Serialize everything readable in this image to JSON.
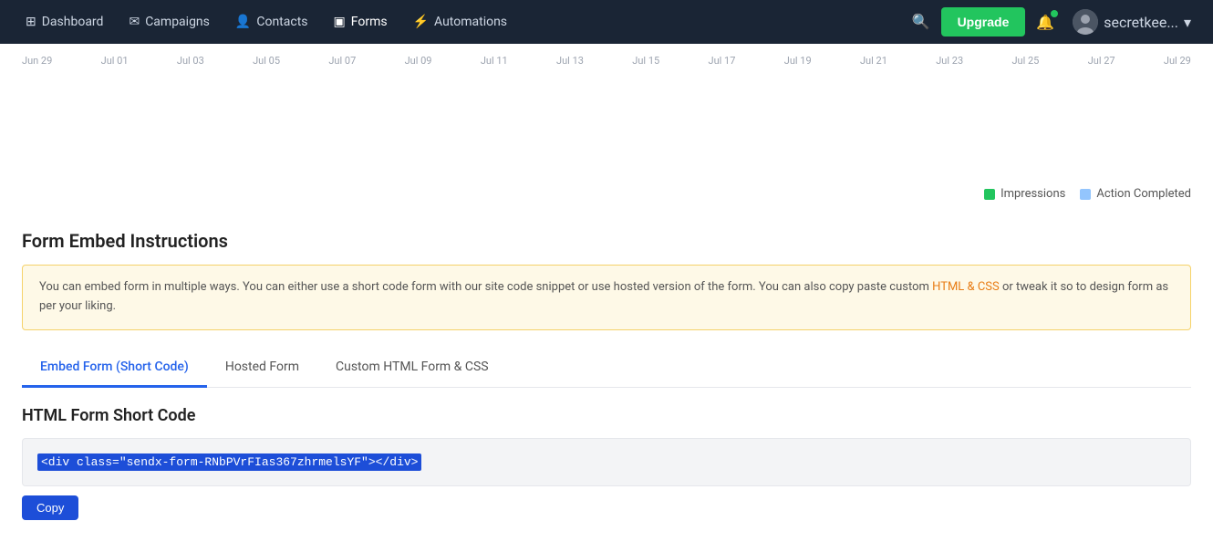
{
  "navbar": {
    "brand_icon": "⊞",
    "items": [
      {
        "id": "dashboard",
        "label": "Dashboard",
        "icon": "grid-icon",
        "active": false
      },
      {
        "id": "campaigns",
        "label": "Campaigns",
        "icon": "mail-icon",
        "active": false
      },
      {
        "id": "contacts",
        "label": "Contacts",
        "icon": "users-icon",
        "active": false
      },
      {
        "id": "forms",
        "label": "Forms",
        "icon": "forms-icon",
        "active": true
      },
      {
        "id": "automations",
        "label": "Automations",
        "icon": "auto-icon",
        "active": false
      }
    ],
    "upgrade_label": "Upgrade",
    "user_name": "secretkee...",
    "user_chevron": "▾"
  },
  "chart": {
    "x_labels": [
      "Jun 29",
      "Jul 01",
      "Jul 03",
      "Jul 05",
      "Jul 07",
      "Jul 09",
      "Jul 11",
      "Jul 13",
      "Jul 15",
      "Jul 17",
      "Jul 19",
      "Jul 21",
      "Jul 23",
      "Jul 25",
      "Jul 27",
      "Jul 29"
    ],
    "legend": {
      "impressions_label": "Impressions",
      "impressions_color": "#22c55e",
      "action_completed_label": "Action Completed",
      "action_completed_color": "#93c5fd"
    }
  },
  "form_embed": {
    "section_title": "Form Embed Instructions",
    "info_text_1": "You can embed form in multiple ways. You can either use a short code form with our site code snippet or use hosted version of the form. You can also copy paste custom ",
    "info_highlight": "HTML & CSS",
    "info_text_2": " or tweak it so to design form as per your liking.",
    "tabs": [
      {
        "id": "embed-short-code",
        "label": "Embed Form (Short Code)",
        "active": true
      },
      {
        "id": "hosted-form",
        "label": "Hosted Form",
        "active": false
      },
      {
        "id": "custom-html",
        "label": "Custom HTML Form & CSS",
        "active": false
      }
    ],
    "code_section_title": "HTML Form Short Code",
    "code_value": "<div class=\"sendx-form-RNbPVrFIas367zhrmelsYF\"></div>",
    "copy_label": "Copy"
  }
}
